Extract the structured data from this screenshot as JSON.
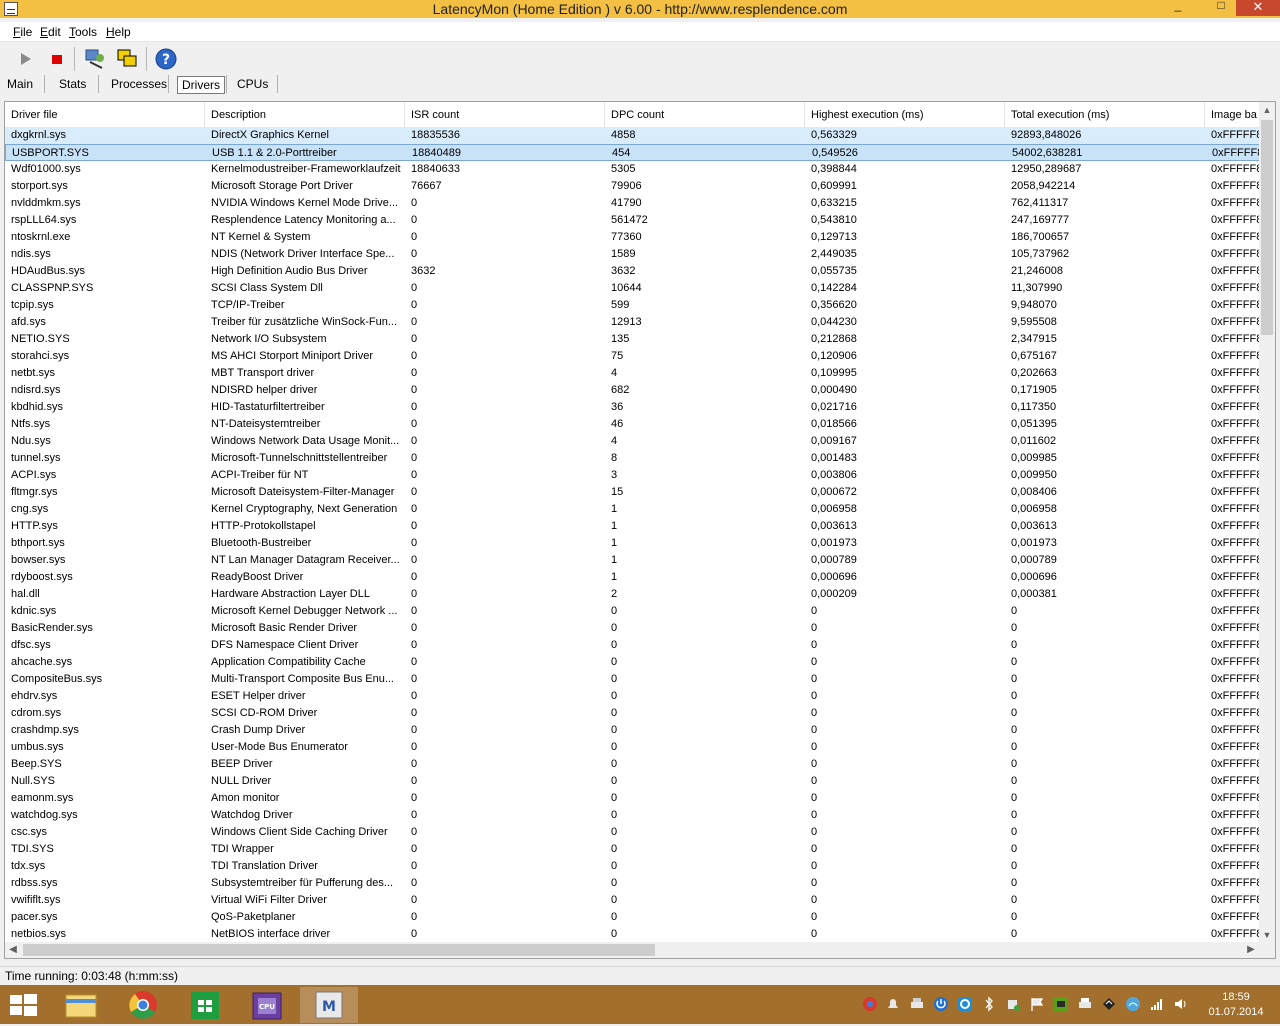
{
  "window": {
    "title": "LatencyMon  (Home Edition )  v 6.00 - http://www.resplendence.com",
    "minimize": "_",
    "maximize": "□",
    "close": "✕"
  },
  "menu": {
    "file": "File",
    "edit": "Edit",
    "tools": "Tools",
    "help": "Help"
  },
  "toolbar": {
    "icons": [
      "play-icon",
      "stop-icon",
      "driver-scan-icon",
      "windows-icon",
      "help-icon"
    ]
  },
  "tabs": {
    "main": "Main",
    "stats": "Stats",
    "processes": "Processes",
    "drivers": "Drivers",
    "cpus": "CPUs",
    "active": "Drivers"
  },
  "grid": {
    "columns": [
      "Driver file",
      "Description",
      "ISR count",
      "DPC count",
      "Highest execution (ms)",
      "Total execution (ms)",
      "Image ba"
    ],
    "rows": [
      [
        "dxgkrnl.sys",
        "DirectX Graphics Kernel",
        "18835536",
        "4858",
        "0,563329",
        "92893,848026",
        "0xFFFFF8"
      ],
      [
        "USBPORT.SYS",
        "USB 1.1 & 2.0-Porttreiber",
        "18840489",
        "454",
        "0,549526",
        "54002,638281",
        "0xFFFFF8"
      ],
      [
        "Wdf01000.sys",
        "Kernelmodustreiber-Frameworklaufzeit",
        "18840633",
        "5305",
        "0,398844",
        "12950,289687",
        "0xFFFFF8"
      ],
      [
        "storport.sys",
        "Microsoft Storage Port Driver",
        "76667",
        "79906",
        "0,609991",
        "2058,942214",
        "0xFFFFF8"
      ],
      [
        "nvlddmkm.sys",
        "NVIDIA Windows Kernel Mode Drive...",
        "0",
        "41790",
        "0,633215",
        "762,411317",
        "0xFFFFF8"
      ],
      [
        "rspLLL64.sys",
        "Resplendence Latency Monitoring a...",
        "0",
        "561472",
        "0,543810",
        "247,169777",
        "0xFFFFF8"
      ],
      [
        "ntoskrnl.exe",
        "NT Kernel & System",
        "0",
        "77360",
        "0,129713",
        "186,700657",
        "0xFFFFF8"
      ],
      [
        "ndis.sys",
        "NDIS (Network Driver Interface Spe...",
        "0",
        "1589",
        "2,449035",
        "105,737962",
        "0xFFFFF8"
      ],
      [
        "HDAudBus.sys",
        "High Definition Audio Bus Driver",
        "3632",
        "3632",
        "0,055735",
        "21,246008",
        "0xFFFFF8"
      ],
      [
        "CLASSPNP.SYS",
        "SCSI Class System Dll",
        "0",
        "10644",
        "0,142284",
        "11,307990",
        "0xFFFFF8"
      ],
      [
        "tcpip.sys",
        "TCP/IP-Treiber",
        "0",
        "599",
        "0,356620",
        "9,948070",
        "0xFFFFF8"
      ],
      [
        "afd.sys",
        "Treiber für zusätzliche WinSock-Fun...",
        "0",
        "12913",
        "0,044230",
        "9,595508",
        "0xFFFFF8"
      ],
      [
        "NETIO.SYS",
        "Network I/O Subsystem",
        "0",
        "135",
        "0,212868",
        "2,347915",
        "0xFFFFF8"
      ],
      [
        "storahci.sys",
        "MS AHCI Storport Miniport Driver",
        "0",
        "75",
        "0,120906",
        "0,675167",
        "0xFFFFF8"
      ],
      [
        "netbt.sys",
        "MBT Transport driver",
        "0",
        "4",
        "0,109995",
        "0,202663",
        "0xFFFFF8"
      ],
      [
        "ndisrd.sys",
        "NDISRD helper driver",
        "0",
        "682",
        "0,000490",
        "0,171905",
        "0xFFFFF8"
      ],
      [
        "kbdhid.sys",
        "HID-Tastaturfiltertreiber",
        "0",
        "36",
        "0,021716",
        "0,117350",
        "0xFFFFF8"
      ],
      [
        "Ntfs.sys",
        "NT-Dateisystemtreiber",
        "0",
        "46",
        "0,018566",
        "0,051395",
        "0xFFFFF8"
      ],
      [
        "Ndu.sys",
        "Windows Network Data Usage Monit...",
        "0",
        "4",
        "0,009167",
        "0,011602",
        "0xFFFFF8"
      ],
      [
        "tunnel.sys",
        "Microsoft-Tunnelschnittstellentreiber",
        "0",
        "8",
        "0,001483",
        "0,009985",
        "0xFFFFF8"
      ],
      [
        "ACPI.sys",
        "ACPI-Treiber für NT",
        "0",
        "3",
        "0,003806",
        "0,009950",
        "0xFFFFF8"
      ],
      [
        "fltmgr.sys",
        "Microsoft Dateisystem-Filter-Manager",
        "0",
        "15",
        "0,000672",
        "0,008406",
        "0xFFFFF8"
      ],
      [
        "cng.sys",
        "Kernel Cryptography, Next Generation",
        "0",
        "1",
        "0,006958",
        "0,006958",
        "0xFFFFF8"
      ],
      [
        "HTTP.sys",
        "HTTP-Protokollstapel",
        "0",
        "1",
        "0,003613",
        "0,003613",
        "0xFFFFF8"
      ],
      [
        "bthport.sys",
        "Bluetooth-Bustreiber",
        "0",
        "1",
        "0,001973",
        "0,001973",
        "0xFFFFF8"
      ],
      [
        "bowser.sys",
        "NT Lan Manager Datagram Receiver...",
        "0",
        "1",
        "0,000789",
        "0,000789",
        "0xFFFFF8"
      ],
      [
        "rdyboost.sys",
        "ReadyBoost Driver",
        "0",
        "1",
        "0,000696",
        "0,000696",
        "0xFFFFF8"
      ],
      [
        "hal.dll",
        "Hardware Abstraction Layer DLL",
        "0",
        "2",
        "0,000209",
        "0,000381",
        "0xFFFFF8"
      ],
      [
        "kdnic.sys",
        "Microsoft Kernel Debugger Network ...",
        "0",
        "0",
        "0",
        "0",
        "0xFFFFF8"
      ],
      [
        "BasicRender.sys",
        "Microsoft Basic Render Driver",
        "0",
        "0",
        "0",
        "0",
        "0xFFFFF8"
      ],
      [
        "dfsc.sys",
        "DFS Namespace Client Driver",
        "0",
        "0",
        "0",
        "0",
        "0xFFFFF8"
      ],
      [
        "ahcache.sys",
        "Application Compatibility Cache",
        "0",
        "0",
        "0",
        "0",
        "0xFFFFF8"
      ],
      [
        "CompositeBus.sys",
        "Multi-Transport Composite Bus Enu...",
        "0",
        "0",
        "0",
        "0",
        "0xFFFFF8"
      ],
      [
        "ehdrv.sys",
        "ESET Helper driver",
        "0",
        "0",
        "0",
        "0",
        "0xFFFFF8"
      ],
      [
        "cdrom.sys",
        "SCSI CD-ROM Driver",
        "0",
        "0",
        "0",
        "0",
        "0xFFFFF8"
      ],
      [
        "crashdmp.sys",
        "Crash Dump Driver",
        "0",
        "0",
        "0",
        "0",
        "0xFFFFF8"
      ],
      [
        "umbus.sys",
        "User-Mode Bus Enumerator",
        "0",
        "0",
        "0",
        "0",
        "0xFFFFF8"
      ],
      [
        "Beep.SYS",
        "BEEP Driver",
        "0",
        "0",
        "0",
        "0",
        "0xFFFFF8"
      ],
      [
        "Null.SYS",
        "NULL Driver",
        "0",
        "0",
        "0",
        "0",
        "0xFFFFF8"
      ],
      [
        "eamonm.sys",
        "Amon monitor",
        "0",
        "0",
        "0",
        "0",
        "0xFFFFF8"
      ],
      [
        "watchdog.sys",
        "Watchdog Driver",
        "0",
        "0",
        "0",
        "0",
        "0xFFFFF8"
      ],
      [
        "csc.sys",
        "Windows Client Side Caching Driver",
        "0",
        "0",
        "0",
        "0",
        "0xFFFFF8"
      ],
      [
        "TDI.SYS",
        "TDI Wrapper",
        "0",
        "0",
        "0",
        "0",
        "0xFFFFF8"
      ],
      [
        "tdx.sys",
        "TDI Translation Driver",
        "0",
        "0",
        "0",
        "0",
        "0xFFFFF8"
      ],
      [
        "rdbss.sys",
        "Subsystemtreiber für Pufferung des...",
        "0",
        "0",
        "0",
        "0",
        "0xFFFFF8"
      ],
      [
        "vwififlt.sys",
        "Virtual WiFi Filter Driver",
        "0",
        "0",
        "0",
        "0",
        "0xFFFFF8"
      ],
      [
        "pacer.sys",
        "QoS-Paketplaner",
        "0",
        "0",
        "0",
        "0",
        "0xFFFFF8"
      ],
      [
        "netbios.sys",
        "NetBIOS interface driver",
        "0",
        "0",
        "0",
        "0",
        "0xFFFFF8"
      ]
    ],
    "selected_rows": [
      0,
      1
    ]
  },
  "statusbar": {
    "text": "Time running: 0:03:48  (h:mm:ss)"
  },
  "taskbar": {
    "apps": [
      "file-explorer-icon",
      "chrome-icon",
      "store-icon",
      "cpuz-icon",
      "latencymon-icon"
    ],
    "active_app": "latencymon-icon",
    "tray_icons": [
      "chrome-tray-icon",
      "notification-icon",
      "network-drive-icon",
      "power-icon",
      "eset-icon",
      "bluetooth-icon",
      "usb-icon",
      "flag-icon",
      "nvidia-icon",
      "printer-icon",
      "sync-icon",
      "signal-icon",
      "volume-icon"
    ],
    "time": "18:59",
    "date": "01.07.2014"
  },
  "colors": {
    "titlebar": "#f3c044",
    "taskbar": "#a36f2c",
    "close": "#c7482c",
    "selection": "#c8e2f8"
  }
}
